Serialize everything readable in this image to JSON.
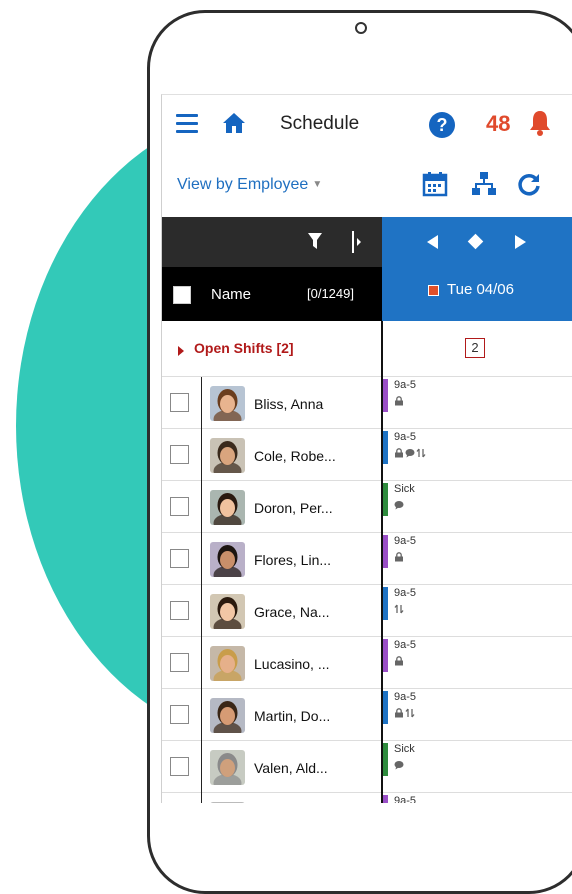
{
  "header": {
    "title": "Schedule",
    "help": "?",
    "notification_count": "48"
  },
  "view": {
    "label": "View by Employee"
  },
  "grid": {
    "name_header": "Name",
    "count": "[0/1249]",
    "date": "Tue 04/06",
    "open_shifts_label": "Open Shifts [2]",
    "open_shifts_count": "2"
  },
  "colors": {
    "accent_blue": "#1f73c4",
    "bar_purple": "#9a4fc7",
    "bar_blue": "#1f73c4",
    "bar_green": "#2e8b3d",
    "alert_red": "#b11a1a"
  },
  "employees": [
    {
      "name": "Bliss, Anna",
      "shift": "9a-5",
      "bar": "purple",
      "icons": [
        "lock-icon"
      ]
    },
    {
      "name": "Cole, Robe...",
      "shift": "9a-5",
      "bar": "blue",
      "icons": [
        "lock-icon",
        "comment-icon",
        "swap-icon"
      ]
    },
    {
      "name": "Doron, Per...",
      "shift": "Sick",
      "bar": "green",
      "icons": [
        "comment-icon"
      ]
    },
    {
      "name": "Flores, Lin...",
      "shift": "9a-5",
      "bar": "purple",
      "icons": [
        "lock-icon"
      ]
    },
    {
      "name": "Grace, Na...",
      "shift": "9a-5",
      "bar": "blue",
      "icons": [
        "swap-icon"
      ]
    },
    {
      "name": "Lucasino, ...",
      "shift": "9a-5",
      "bar": "purple",
      "icons": [
        "lock-icon"
      ]
    },
    {
      "name": "Martin, Do...",
      "shift": "9a-5",
      "bar": "blue",
      "icons": [
        "lock-icon",
        "swap-icon"
      ]
    },
    {
      "name": "Valen, Ald...",
      "shift": "Sick",
      "bar": "green",
      "icons": [
        "comment-icon"
      ]
    },
    {
      "name": "",
      "shift": "9a-5",
      "bar": "purple",
      "icons": []
    }
  ]
}
